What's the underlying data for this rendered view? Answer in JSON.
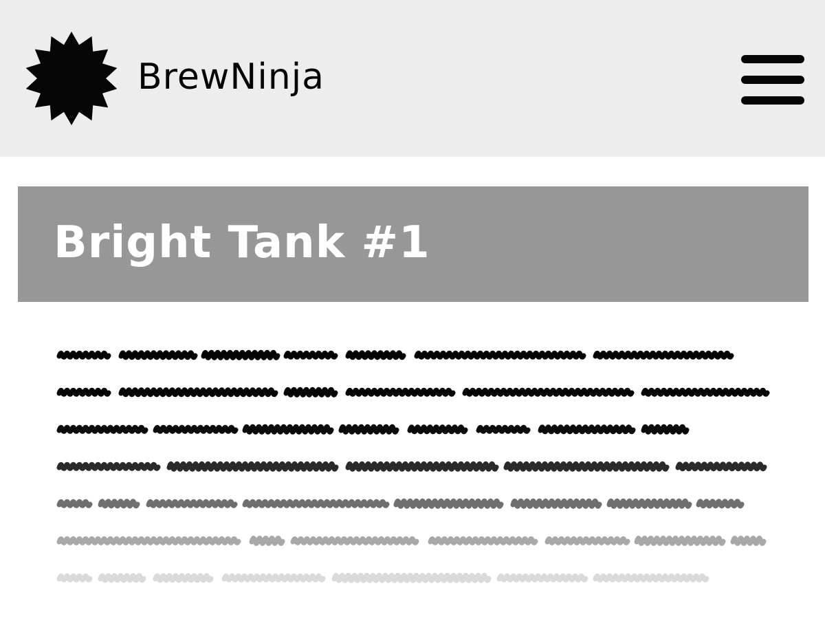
{
  "header": {
    "brand_name": "BrewNinja",
    "logo_icon": "starburst-icon",
    "menu_icon": "hamburger-menu-icon"
  },
  "main": {
    "title": "Bright Tank #1"
  },
  "colors": {
    "header_bg": "#ededee",
    "title_bar_bg": "#979797",
    "title_text": "#ffffff",
    "body_text": "#050505"
  }
}
